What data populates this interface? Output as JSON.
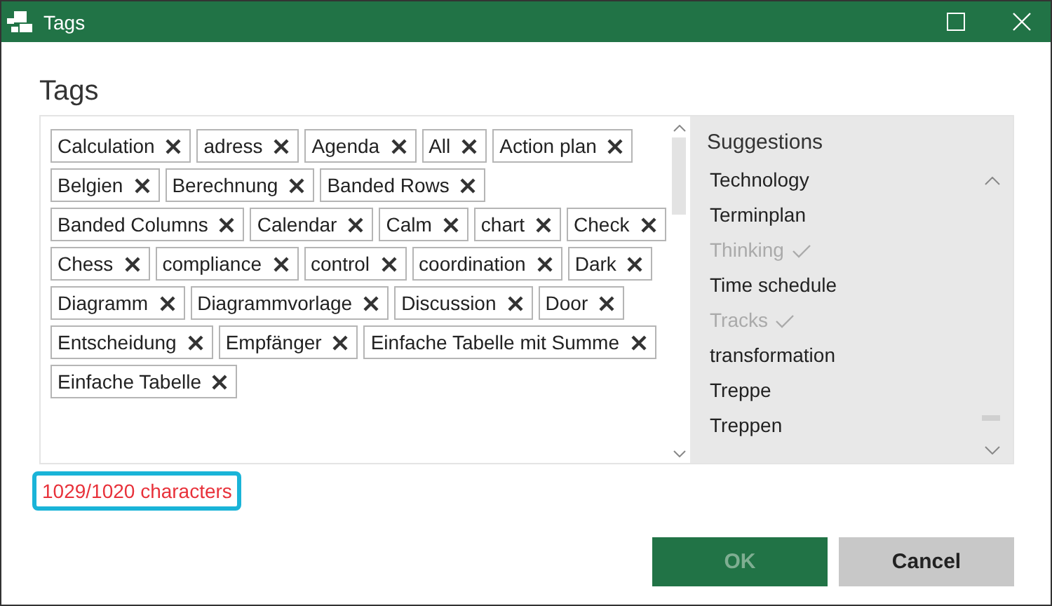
{
  "window": {
    "title": "Tags"
  },
  "heading": "Tags",
  "tags": [
    {
      "label": "Calculation"
    },
    {
      "label": "adress"
    },
    {
      "label": "Agenda"
    },
    {
      "label": "All"
    },
    {
      "label": "Action plan"
    },
    {
      "label": "Belgien"
    },
    {
      "label": "Berechnung"
    },
    {
      "label": "Banded Rows"
    },
    {
      "label": "Banded Columns"
    },
    {
      "label": "Calendar"
    },
    {
      "label": "Calm"
    },
    {
      "label": "chart"
    },
    {
      "label": "Check"
    },
    {
      "label": "Chess"
    },
    {
      "label": "compliance"
    },
    {
      "label": "control"
    },
    {
      "label": "coordination"
    },
    {
      "label": "Dark"
    },
    {
      "label": "Diagramm"
    },
    {
      "label": "Diagrammvorlage"
    },
    {
      "label": "Discussion"
    },
    {
      "label": "Door"
    },
    {
      "label": "Entscheidung"
    },
    {
      "label": "Empfänger"
    },
    {
      "label": "Einfache Tabelle mit Summe"
    },
    {
      "label": "Einfache Tabelle"
    }
  ],
  "suggestions": {
    "title": "Suggestions",
    "items": [
      {
        "label": "Technology",
        "added": false
      },
      {
        "label": "Terminplan",
        "added": false
      },
      {
        "label": "Thinking",
        "added": true
      },
      {
        "label": "Time schedule",
        "added": false
      },
      {
        "label": "Tracks",
        "added": true
      },
      {
        "label": "transformation",
        "added": false
      },
      {
        "label": "Treppe",
        "added": false
      },
      {
        "label": "Treppen",
        "added": false
      }
    ]
  },
  "counter": {
    "text": "1029/1020 characters",
    "over_limit": true
  },
  "buttons": [
    {
      "label": "OK",
      "kind": "primary",
      "disabled": true
    },
    {
      "label": "Cancel",
      "kind": "secondary",
      "disabled": false
    }
  ]
}
